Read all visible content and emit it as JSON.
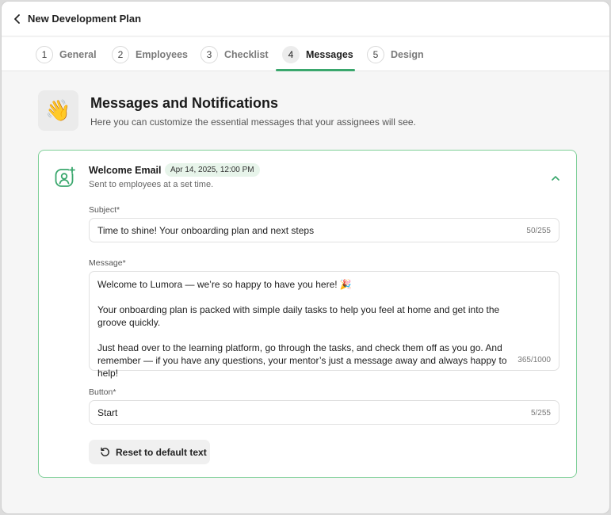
{
  "window": {
    "title": "New Development Plan"
  },
  "tabs": [
    {
      "num": "1",
      "label": "General"
    },
    {
      "num": "2",
      "label": "Employees"
    },
    {
      "num": "3",
      "label": "Checklist"
    },
    {
      "num": "4",
      "label": "Messages"
    },
    {
      "num": "5",
      "label": "Design"
    }
  ],
  "active_tab": "Messages",
  "header": {
    "icon": "waving-hand-icon",
    "title": "Messages and Notifications",
    "subtitle": "Here you can customize the essential messages that your assignees will see."
  },
  "card": {
    "icon": "user-add-icon",
    "title": "Welcome Email",
    "date": "Apr 14, 2025, 12:00 PM",
    "subtitle": "Sent to employees at a set time.",
    "subject": {
      "label": "Subject*",
      "value": "Time to shine! Your onboarding plan and next steps",
      "count": "50/255"
    },
    "message": {
      "label": "Message*",
      "line1": "Welcome to Lumora — we’re so happy to have you here! 🎉",
      "line2": "Your onboarding plan is packed with simple daily tasks to help you feel at home and get into the groove quickly.",
      "line3": "Just head over to the learning platform, go through the tasks, and check them off as you go. And remember — if you have any questions, your mentor’s just a message away and always happy to help!",
      "count": "365/1000"
    },
    "button_field": {
      "label": "Button*",
      "value": "Start",
      "count": "5/255"
    },
    "reset_label": "Reset to default text"
  },
  "colors": {
    "accent": "#3aa76d",
    "card_border": "#7fcf98",
    "badge_bg": "#e7f4ea"
  }
}
